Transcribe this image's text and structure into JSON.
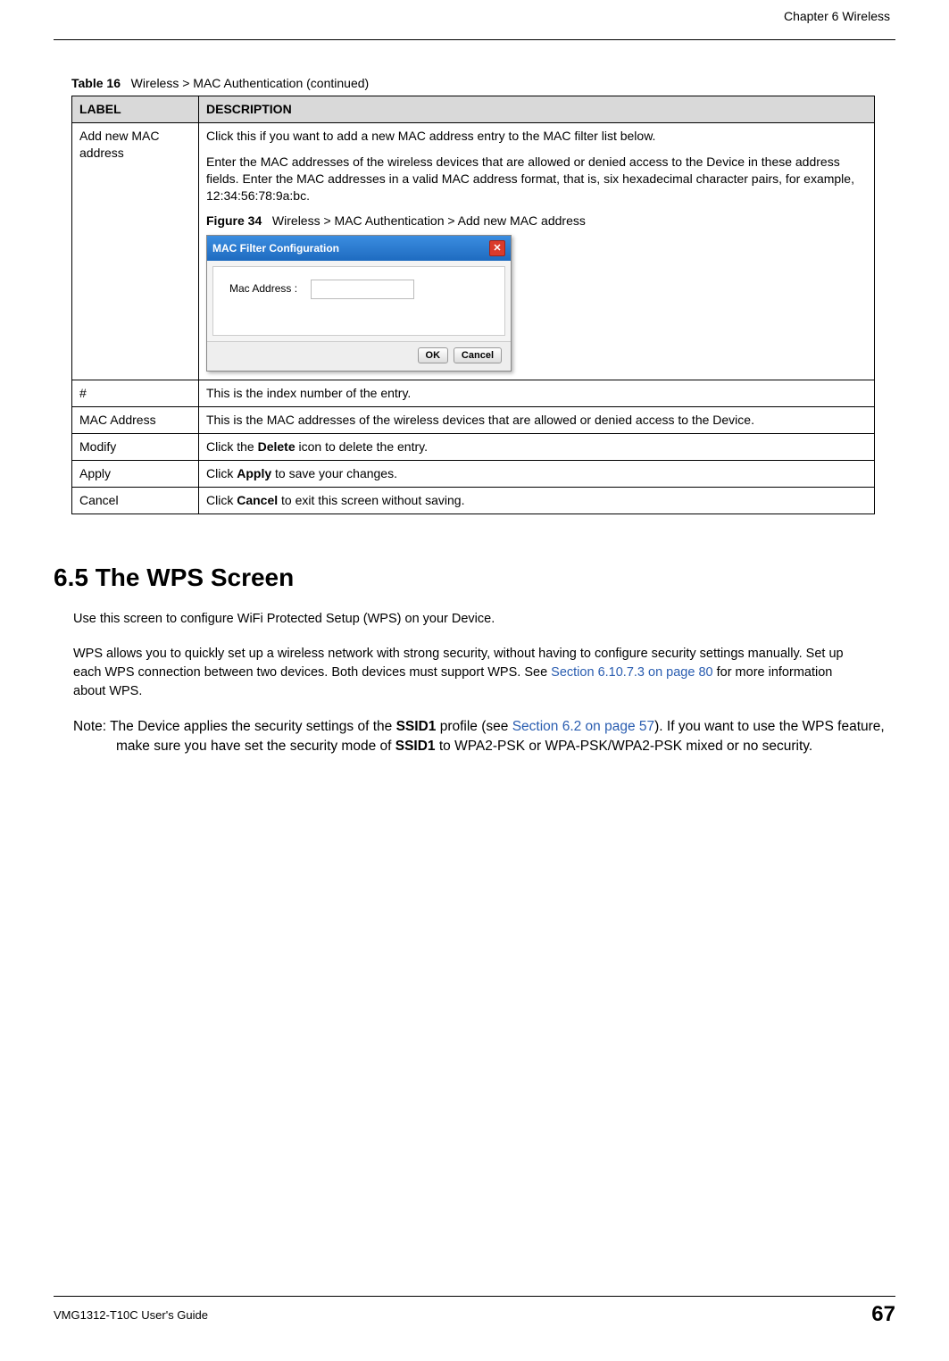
{
  "header": {
    "chapter": "Chapter 6 Wireless"
  },
  "table_caption": {
    "label": "Table 16",
    "text": "Wireless > MAC Authentication (continued)"
  },
  "table": {
    "head_label": "LABEL",
    "head_desc": "DESCRIPTION",
    "row1": {
      "label": "Add new MAC address",
      "desc1": "Click this if you want to add a new MAC address entry to the MAC filter list below.",
      "desc2": "Enter the MAC addresses of the wireless devices that are allowed or denied access to the Device in these address fields. Enter the MAC addresses in a valid MAC address format, that is, six hexadecimal character pairs, for example, 12:34:56:78:9a:bc.",
      "fig_label": "Figure 34",
      "fig_text": "Wireless > MAC Authentication > Add new MAC address"
    },
    "row2": {
      "label": "#",
      "desc": "This is the index number of the entry."
    },
    "row3": {
      "label": "MAC Address",
      "desc": "This is the MAC addresses of the wireless devices that are allowed or denied access to the Device."
    },
    "row4": {
      "label": "Modify",
      "desc_pre": "Click the ",
      "desc_bold": "Delete",
      "desc_post": " icon to delete the entry."
    },
    "row5": {
      "label": "Apply",
      "desc_pre": "Click ",
      "desc_bold": "Apply",
      "desc_post": " to save your changes."
    },
    "row6": {
      "label": "Cancel",
      "desc_pre": "Click ",
      "desc_bold": "Cancel",
      "desc_post": " to exit this screen without saving."
    }
  },
  "dialog": {
    "title": "MAC Filter Configuration",
    "field_label": "Mac Address :",
    "ok": "OK",
    "cancel": "Cancel"
  },
  "section": {
    "title": "6.5  The WPS Screen",
    "p1": "Use this screen to configure WiFi Protected Setup (WPS) on your Device.",
    "p2_pre": "WPS allows you to quickly set up a wireless network with strong security, without having to configure security settings manually. Set up each WPS connection between two devices. Both devices must support WPS. See ",
    "p2_link": "Section 6.10.7.3 on page 80",
    "p2_post": " for more information about WPS.",
    "note_pre": "Note: The Device applies the security settings of the ",
    "note_b1": "SSID1",
    "note_mid1": " profile (see ",
    "note_link": "Section 6.2 on page 57",
    "note_mid2": "). If you want to use the WPS feature, make sure you have set the security mode of ",
    "note_b2": "SSID1",
    "note_post": " to WPA2-PSK or WPA-PSK/WPA2-PSK mixed or no security."
  },
  "footer": {
    "guide": "VMG1312-T10C User's Guide",
    "page": "67"
  }
}
